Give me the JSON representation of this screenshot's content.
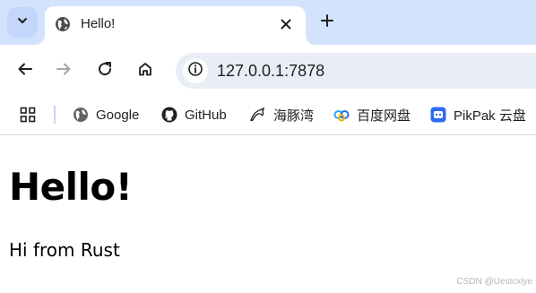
{
  "browser": {
    "tab": {
      "title": "Hello!"
    },
    "toolbar": {
      "url": "127.0.0.1:7878"
    },
    "bookmarks": [
      {
        "label": "Google",
        "icon": "globe-icon"
      },
      {
        "label": "GitHub",
        "icon": "github-icon"
      },
      {
        "label": "海豚湾",
        "icon": "dolphin-icon"
      },
      {
        "label": "百度网盘",
        "icon": "baidu-netdisk-icon"
      },
      {
        "label": "PikPak 云盘",
        "icon": "pikpak-icon"
      }
    ]
  },
  "page": {
    "heading": "Hello!",
    "paragraph": "Hi from Rust"
  },
  "watermark": "CSDN @Uestcxiye",
  "colors": {
    "tabstrip": "#d3e3fd",
    "omnibox": "#e9eef6",
    "accent": "#1a73e8"
  }
}
